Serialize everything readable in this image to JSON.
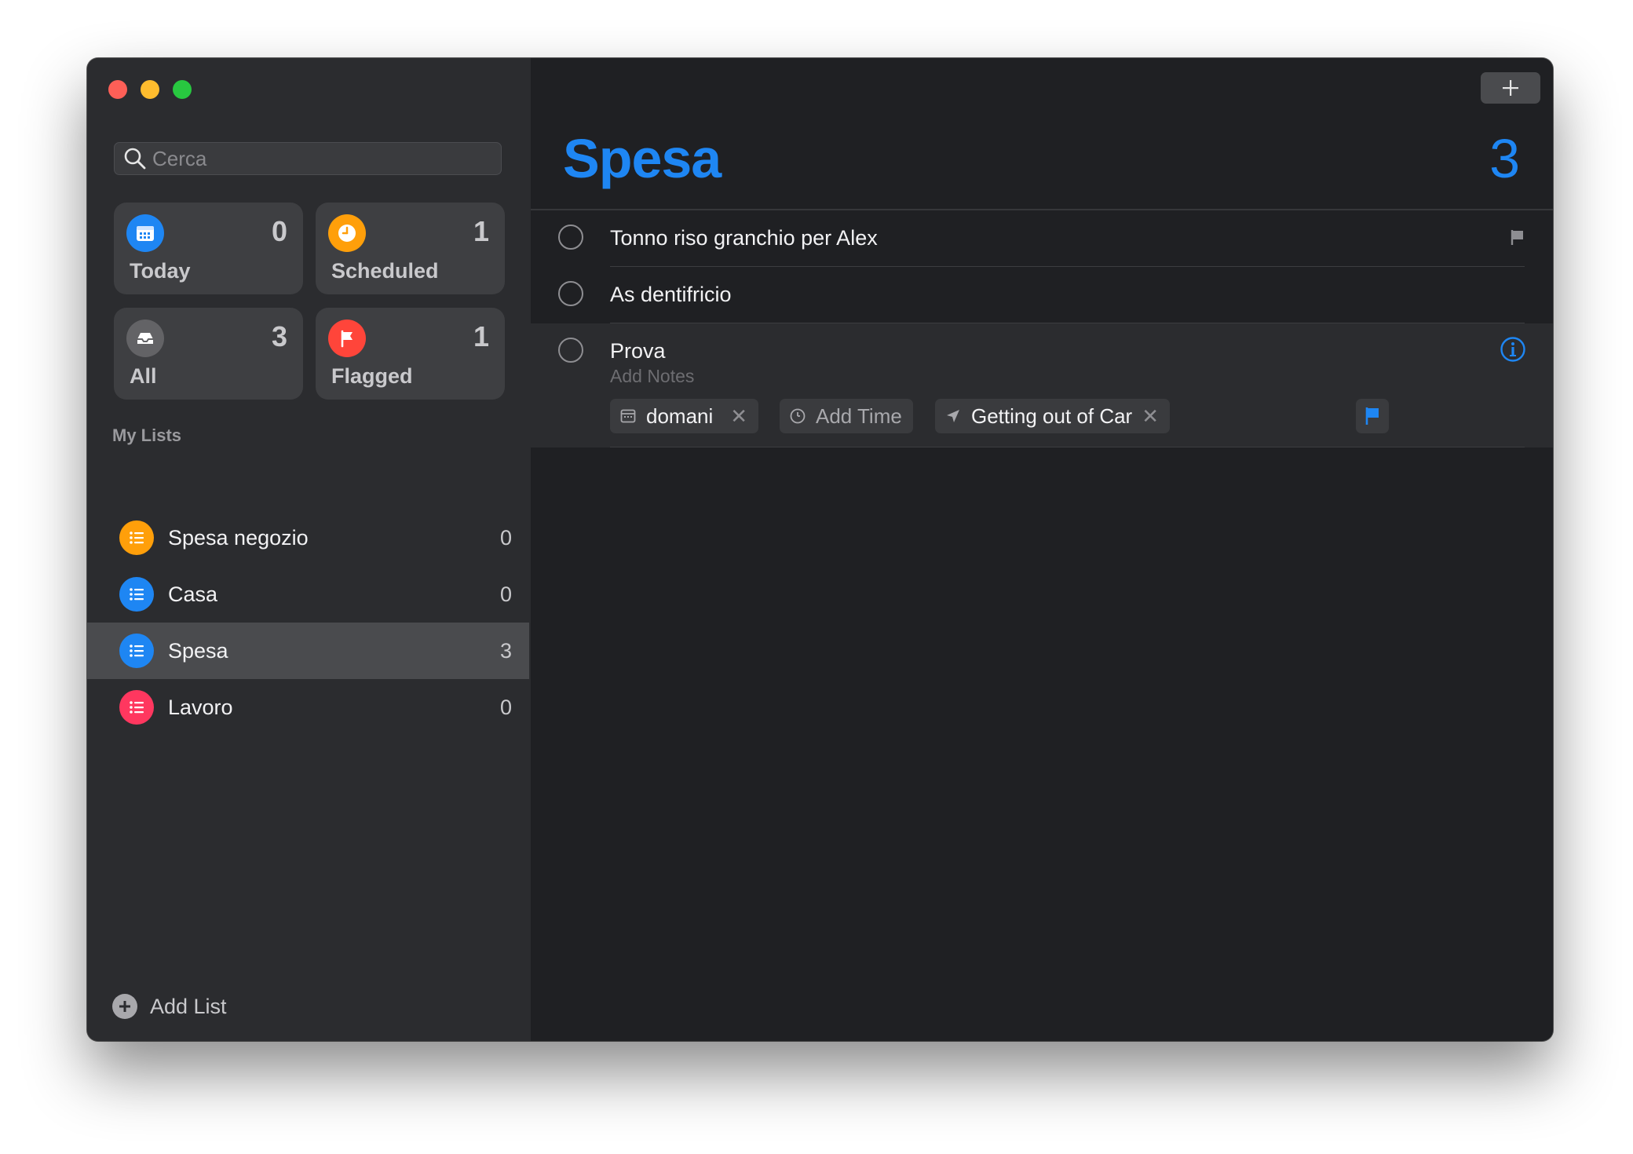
{
  "sidebar": {
    "search": {
      "placeholder": "Cerca",
      "value": ""
    },
    "smart_lists": [
      {
        "label": "Today",
        "count": "0",
        "icon": "calendar-icon",
        "color": "#1e86f3"
      },
      {
        "label": "Scheduled",
        "count": "1",
        "icon": "clock-icon",
        "color": "#ff9f0a"
      },
      {
        "label": "All",
        "count": "3",
        "icon": "tray-icon",
        "color": "#636366"
      },
      {
        "label": "Flagged",
        "count": "1",
        "icon": "flag-icon",
        "color": "#ff453a"
      }
    ],
    "my_lists_header": "My Lists",
    "lists": [
      {
        "label": "Spesa negozio",
        "count": "0",
        "color": "#ff9f0a"
      },
      {
        "label": "Casa",
        "count": "0",
        "color": "#1e86f3"
      },
      {
        "label": "Spesa",
        "count": "3",
        "color": "#1e86f3",
        "selected": true
      },
      {
        "label": "Lavoro",
        "count": "0",
        "color": "#ff375f"
      }
    ],
    "add_list_label": "Add List"
  },
  "main": {
    "title": "Spesa",
    "total": "3",
    "accent": "#1e86f3",
    "tasks": [
      {
        "title": "Tonno riso granchio per Alex",
        "flagged": true
      },
      {
        "title": "As dentifricio",
        "flagged": false
      },
      {
        "title": "Prova",
        "notes_placeholder": "Add Notes",
        "chips": {
          "date": "domani",
          "time": "Add Time",
          "location": "Getting out of Car"
        }
      }
    ]
  }
}
